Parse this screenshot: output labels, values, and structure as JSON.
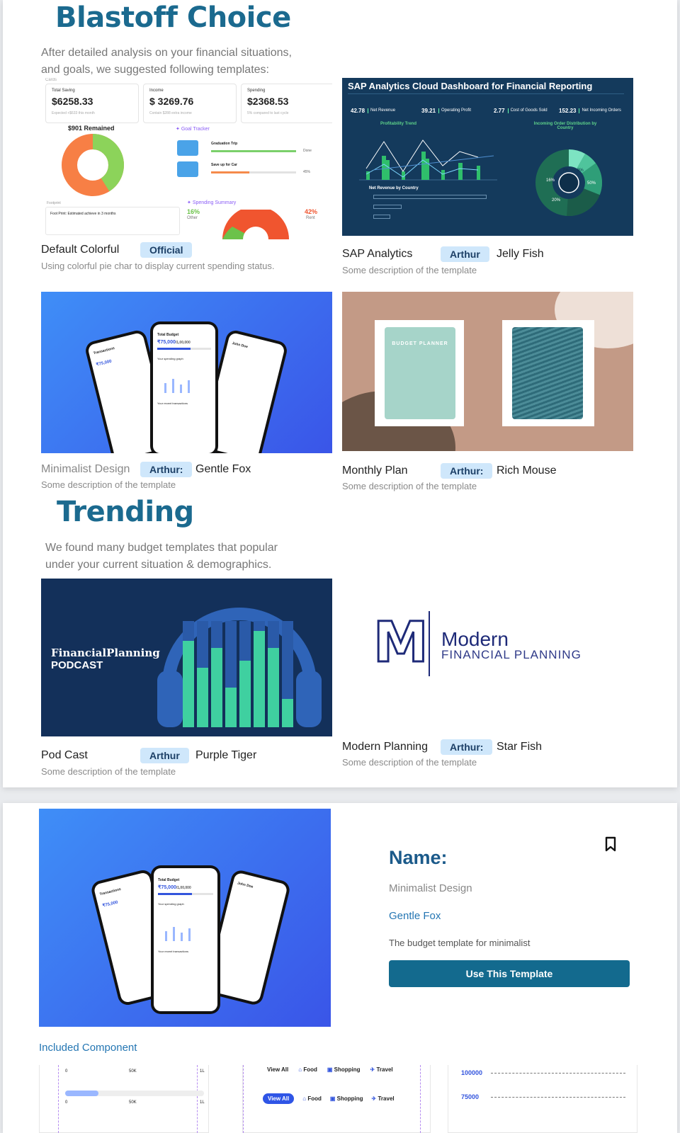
{
  "choice": {
    "title": "Blastoff Choice",
    "subtitle_line1": "After detailed analysis on your financial situations,",
    "subtitle_line2": "and goals, we suggested following templates:"
  },
  "templates": [
    {
      "name": "Default Colorful",
      "badge": "Official",
      "author": "",
      "desc": "Using colorful pie char to display current spending status."
    },
    {
      "name": "SAP Analytics",
      "badge": "Arthur",
      "author": "Jelly Fish",
      "desc": "Some description of the template"
    },
    {
      "name": "Minimalist Design",
      "badge": "Arthur:",
      "author": "Gentle Fox",
      "desc": "Some description of the template"
    },
    {
      "name": "Monthly Plan",
      "badge": "Arthur:",
      "author": "Rich Mouse",
      "desc": "Some description of the template"
    }
  ],
  "trending": {
    "title": "Trending",
    "subtitle_line1": "We found many budget templates that popular",
    "subtitle_line2": "under your current situation & demographics.",
    "items": [
      {
        "name": "Pod Cast",
        "badge": "Arthur",
        "author": "Purple Tiger",
        "desc": "Some description of the template"
      },
      {
        "name": "Modern Planning",
        "badge": "Arthur:",
        "author": "Star Fish",
        "desc": "Some description of the template"
      }
    ]
  },
  "colorful_thumb": {
    "cards_label": "Cards",
    "cards": [
      {
        "label": "Total Saving",
        "value": "$6258.33",
        "note": "Expected +$633 this month"
      },
      {
        "label": "Income",
        "value": "$ 3269.76",
        "note": "Contain $288 extra income"
      },
      {
        "label": "Spending",
        "value": "$2368.53",
        "note": "5% compared to last cycle"
      }
    ],
    "remained": "$901 Remained",
    "goal_tracker": "Goal Tracker",
    "goals": [
      {
        "label": "Graduation Trip",
        "status": "Done",
        "progress": 1.0
      },
      {
        "label": "Save up for Car",
        "status": "45%",
        "progress": 0.45
      }
    ],
    "footprint": "Footprint",
    "footprint_text": "Foot Print: Estimated achieve in 3 months",
    "spending_summary": "Spending Summary",
    "other_pct": "16%",
    "other_label": "Other",
    "rent_pct": "42%",
    "rent_label": "Rent",
    "colors": {
      "donut_orange": "#f77f45",
      "donut_green": "#8cd35a",
      "progress_green": "#7bd06b",
      "progress_orange": "#f58a4b"
    }
  },
  "sap_thumb": {
    "title": "SAP Analytics Cloud Dashboard for Financial Reporting",
    "kpis": [
      {
        "value": "42.78",
        "label": "Net Revenue"
      },
      {
        "value": "39.21",
        "label": "Operating Profit"
      },
      {
        "value": "2.77",
        "label": "Cost of Goods Sold"
      },
      {
        "value": "152.23",
        "label": "Net Incoming Orders"
      }
    ],
    "trend_title": "Profitability Trend",
    "country_title": "Net Revenue by Country",
    "distribution_title": "Incoming Order Distribution by Country",
    "pie": [
      {
        "pct": "8%",
        "value": 8
      },
      {
        "pct": "7%",
        "value": 7
      },
      {
        "pct": "16%",
        "value": 16
      },
      {
        "pct": "20%",
        "value": 20
      },
      {
        "pct": "50%",
        "value": 50
      }
    ],
    "bg": "#143a5c"
  },
  "budget_planners": {
    "cover_text": "BUDGET PLANNER"
  },
  "podcast": {
    "line1": "FinancialPlanning",
    "line2": "PODCAST"
  },
  "modern_logo": {
    "letter": "M",
    "word1": "Modern",
    "word2": "FINANCIAL PLANNING"
  },
  "detail": {
    "name_label": "Name:",
    "name_value": "Minimalist Design",
    "author": "Gentle Fox",
    "description": "The budget template for minimalist",
    "use_button": "Use This Template",
    "included_label": "Included Component",
    "components": {
      "slider": {
        "min": "0",
        "mid": "50K",
        "max": "1L"
      },
      "filters": {
        "view_all": "View All",
        "food": "Food",
        "shopping": "Shopping",
        "travel": "Travel"
      },
      "axis": {
        "v1": "100000",
        "v2": "75000"
      }
    }
  },
  "phone_app": {
    "title": "Total Budget",
    "amount": "₹75,000",
    "amount_sub": "/1,00,000",
    "graph_label": "Your spending graph",
    "recent_label": "Your recent transactions",
    "left_title": "Transactions",
    "left_amount": "₹75,000",
    "right_name": "John Doe"
  }
}
